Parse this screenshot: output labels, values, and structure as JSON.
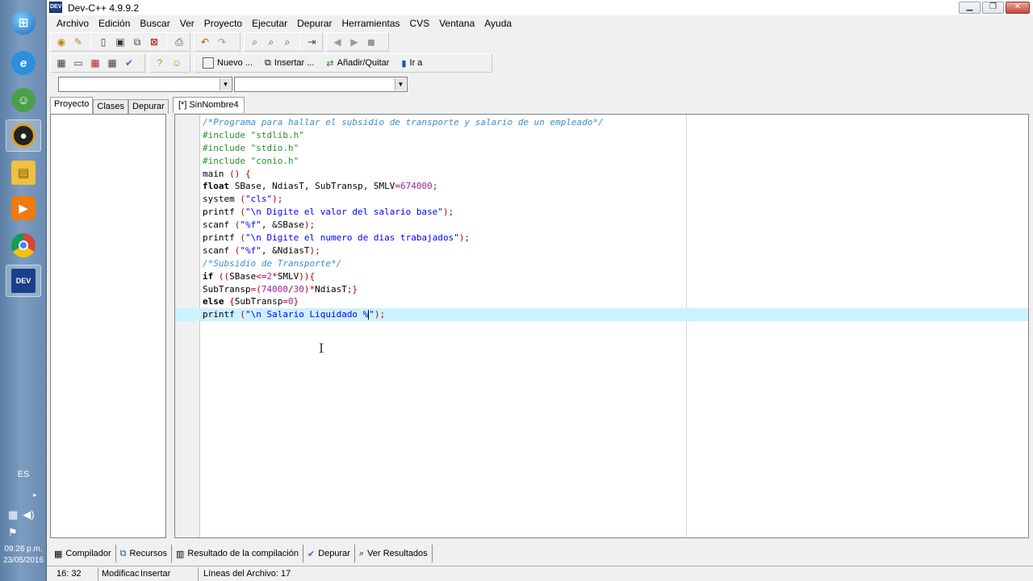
{
  "window": {
    "title": "Dev-C++ 4.9.9.2",
    "app_icon_text": "DEV"
  },
  "menu": [
    "Archivo",
    "Edición",
    "Buscar",
    "Ver",
    "Proyecto",
    "Ejecutar",
    "Depurar",
    "Herramientas",
    "CVS",
    "Ventana",
    "Ayuda"
  ],
  "toolbar2": {
    "nuevo": "Nuevo ...",
    "insertar": "Insertar ...",
    "anadir": "Añadir/Quitar",
    "ira": "Ir a"
  },
  "left_tabs": [
    "Proyecto",
    "Clases",
    "Depurar"
  ],
  "editor_tab": "[*] SinNombre4",
  "code_lines": [
    "/*Programa para hallar el subsidio de transporte y salario de un empleado*/",
    "#include \"stdlib.h\"",
    "#include \"stdio.h\"",
    "#include \"conio.h\"",
    "main () {",
    "float SBase, NdiasT, SubTransp, SMLV=674000;",
    "system (\"cls\");",
    "printf (\"\\n Digite el valor del salario base\");",
    "scanf (\"%f\", &SBase);",
    "printf (\"\\n Digite el numero de dias trabajados\");",
    "scanf (\"%f\", &NdiasT);",
    "/*Subsidio de Transporte*/",
    "if ((SBase<=2*SMLV)){",
    "SubTransp=(74000/30)*NdiasT;}",
    "else {SubTransp=0}",
    "printf (\"\\n Salario Liquidado %\");"
  ],
  "bottom_tabs": [
    "Compilador",
    "Recursos",
    "Resultado de la compilación",
    "Depurar",
    "Ver Resultados"
  ],
  "status": {
    "position": "16: 32",
    "modified": "Modificac",
    "mode": "Insertar",
    "lines": "Líneas del Archivo: 17"
  },
  "taskbar": {
    "lang": "ES",
    "time": "09:26 p.m.",
    "date": "23/05/2016",
    "dev_icon_text": "DEV"
  }
}
